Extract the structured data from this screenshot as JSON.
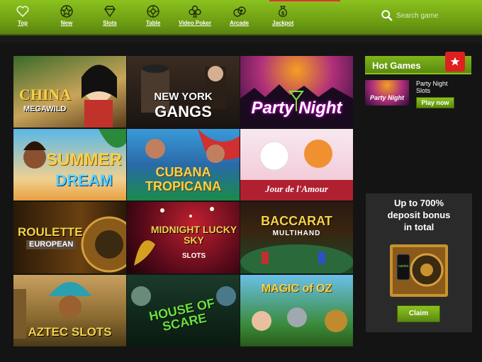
{
  "nav": {
    "items": [
      {
        "label": "Top",
        "icon": "heart-icon"
      },
      {
        "label": "New",
        "icon": "star-icon"
      },
      {
        "label": "Slots",
        "icon": "diamond-icon"
      },
      {
        "label": "Table",
        "icon": "roulette-icon"
      },
      {
        "label": "Video Poker",
        "icon": "club-icon"
      },
      {
        "label": "Arcade",
        "icon": "arcade-icon"
      },
      {
        "label": "Jackpot",
        "icon": "money-bag-icon"
      }
    ],
    "search_placeholder": "Search game"
  },
  "games": [
    {
      "title": "CHINA",
      "subtitle": "MEGAWILD"
    },
    {
      "title": "NEW YORK",
      "subtitle": "GANGS"
    },
    {
      "title": "Party",
      "subtitle": "Night"
    },
    {
      "title": "SUMMER",
      "subtitle": "DREAM"
    },
    {
      "title": "CUBANA",
      "subtitle": "TROPICANA"
    },
    {
      "title": "Jour de l'Amour",
      "subtitle": ""
    },
    {
      "title": "ROULETTE",
      "subtitle": "EUROPEAN"
    },
    {
      "title": "MIDNIGHT LUCKY SKY",
      "subtitle": "SLOTS"
    },
    {
      "title": "BACCARAT",
      "subtitle": "MULTIHAND"
    },
    {
      "title": "AZTEC SLOTS",
      "subtitle": ""
    },
    {
      "title": "HOUSE OF SCARE",
      "subtitle": ""
    },
    {
      "title": "MAGIC of OZ",
      "subtitle": ""
    }
  ],
  "sidebar": {
    "hot_title": "Hot Games",
    "hot_game": {
      "name": "Party Night Slots",
      "thumb_caption": "Party Night",
      "play_label": "Play now"
    },
    "promo": {
      "line1": "Up to 700%",
      "line2": "deposit bonus",
      "line3": "in total",
      "claim_label": "Claim",
      "art_caption": "casino"
    }
  },
  "colors": {
    "accent": "#7fb41a",
    "badge": "#e02020"
  }
}
